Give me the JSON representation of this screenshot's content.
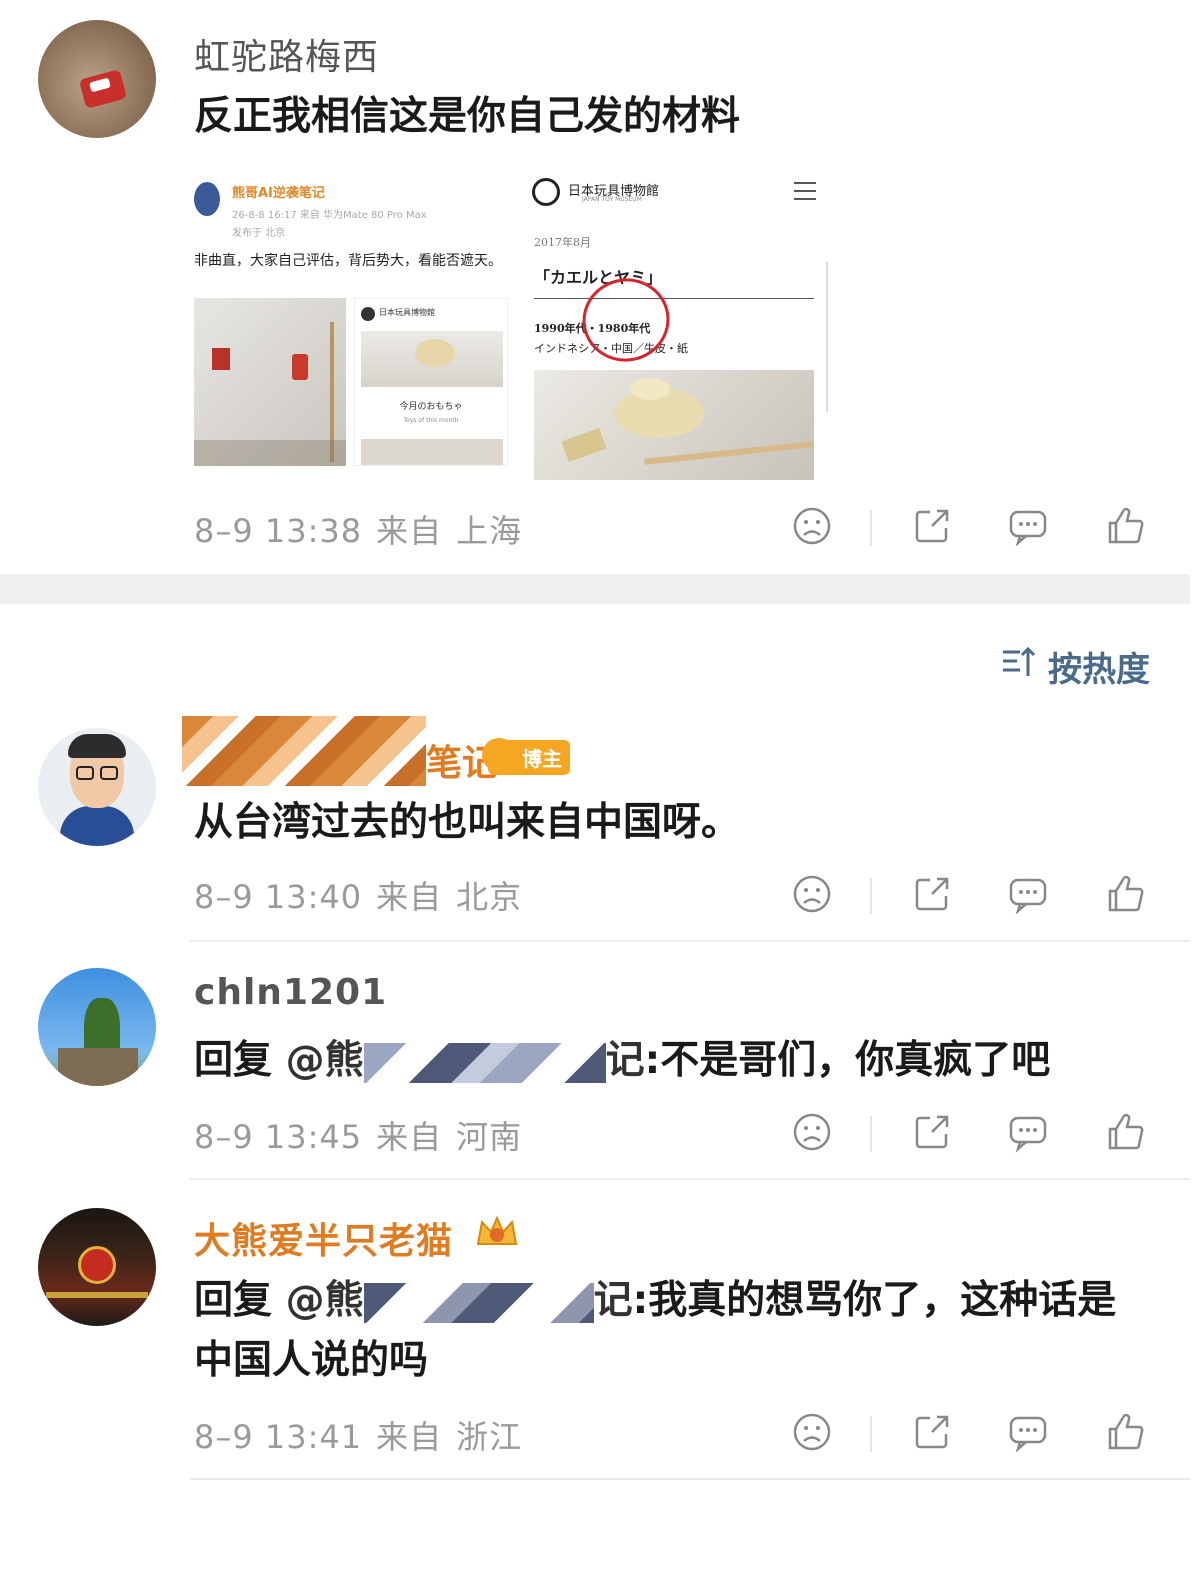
{
  "post": {
    "username": "虹驼路梅西",
    "text": "反正我相信这是你自己发的材料",
    "meta_date": "8–9 13:38",
    "meta_from": "来自",
    "meta_location": "上海",
    "screenshot_left": {
      "author": "熊哥AI逆袭笔记",
      "post_info": "26-8-8 16:17  来自 华为Mate 80 Pro Max",
      "post_location": "发布于 北京",
      "post_text": "非曲直，大家自己评估，背后势大，看能否遮天。",
      "inner_site": "日本玩具博物館",
      "inner_caption": "今月のおもちゃ",
      "inner_subcaption": "Toys of this month"
    },
    "screenshot_right": {
      "site_name": "日本玩具博物館",
      "site_sub": "JAPAN TOY MUSEUM",
      "date": "2017年8月",
      "title": "「カエルとヤミ」",
      "years": "1990年代・1980年代",
      "origin": "インドネシア・中国／牛皮・紙"
    }
  },
  "sort": {
    "icon": "sort-icon",
    "label": "按热度"
  },
  "comments": [
    {
      "username_suffix": "笔记",
      "badge": "博主",
      "text": "从台湾过去的也叫来自中国呀。",
      "meta_date": "8–9 13:40",
      "meta_from": "来自",
      "meta_location": "北京"
    },
    {
      "username": "chln1201",
      "reply_prefix": "回复",
      "mention_start": "@熊",
      "mention_end": "记",
      "text": ":不是哥们，你真疯了吧",
      "meta_date": "8–9 13:45",
      "meta_from": "来自",
      "meta_location": "河南"
    },
    {
      "username": "大熊爱半只老猫",
      "reply_prefix": "回复",
      "mention_start": "@熊",
      "mention_end": "记",
      "text": ":我真的想骂你了，这种话是",
      "text_line2": "中国人说的吗",
      "meta_date": "8–9 13:41",
      "meta_from": "来自",
      "meta_location": "浙江"
    }
  ],
  "colors": {
    "username_orange": "#e07b20",
    "meta_gray": "#9a9a9a",
    "sort_blue": "#4a6a8a",
    "badge_gold": "#f5a623"
  }
}
